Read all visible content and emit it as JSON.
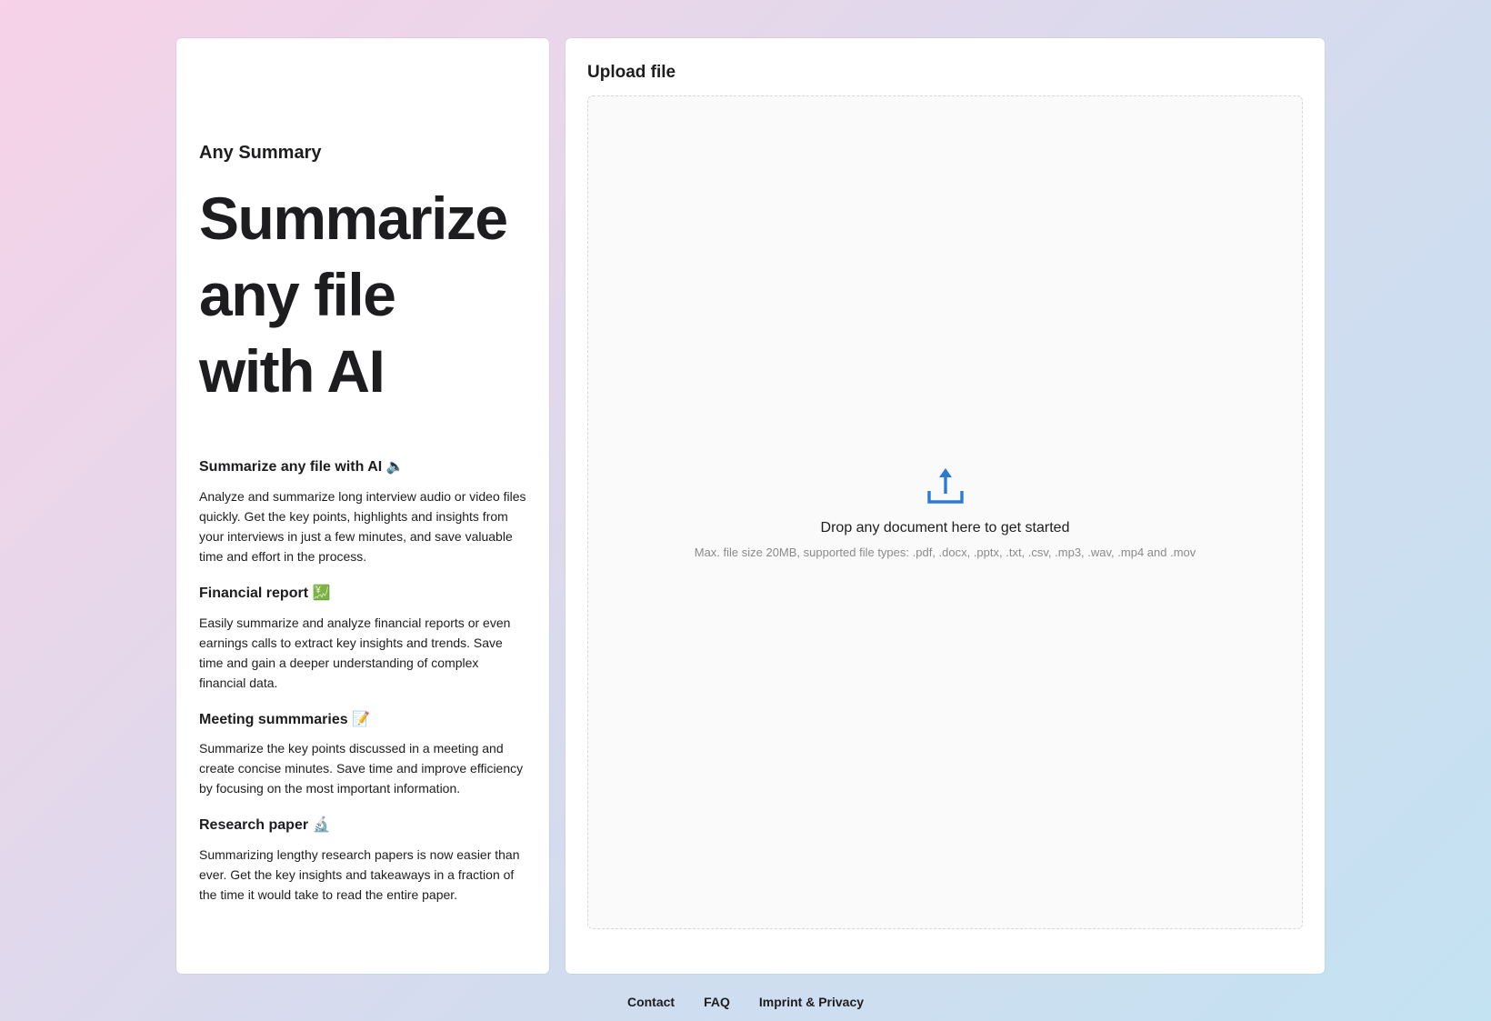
{
  "left": {
    "brand": "Any Summary",
    "hero_lines": [
      "Summarize",
      "any file",
      "with AI"
    ],
    "features": [
      {
        "title": "Summarize any file with AI 🔈",
        "desc": "Analyze and summarize long interview audio or video files quickly. Get the key points, highlights and insights from your interviews in just a few minutes, and save valuable time and effort in the process."
      },
      {
        "title": "Financial report 💹",
        "desc": "Easily summarize and analyze financial reports or even earnings calls to extract key insights and trends. Save time and gain a deeper understanding of complex financial data."
      },
      {
        "title": "Meeting summmaries 📝",
        "desc": "Summarize the key points discussed in a meeting and create concise minutes. Save time and improve efficiency by focusing on the most important information."
      },
      {
        "title": "Research paper 🔬",
        "desc": "Summarizing lengthy research papers is now easier than ever. Get the key insights and takeaways in a fraction of the time it would take to read the entire paper."
      }
    ]
  },
  "upload": {
    "title": "Upload file",
    "drop_text": "Drop any document here to get started",
    "drop_sub": "Max. file size 20MB, supported file types: .pdf, .docx, .pptx, .txt, .csv, .mp3, .wav, .mp4 and .mov",
    "icon": "upload-icon",
    "accent_color": "#2b7bd3"
  },
  "footer": {
    "links": [
      "Contact",
      "FAQ",
      "Imprint & Privacy"
    ]
  }
}
